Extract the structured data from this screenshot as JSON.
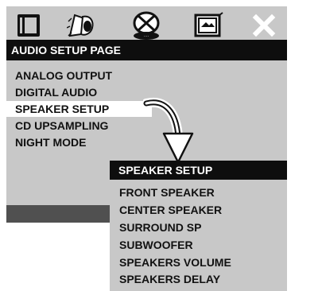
{
  "tabs": [
    {
      "icon": "monitor-icon"
    },
    {
      "icon": "speaker-icon"
    },
    {
      "icon": "disc-icon"
    },
    {
      "icon": "screen-photo-icon"
    },
    {
      "icon": "close-icon"
    }
  ],
  "page_header": "AUDIO SETUP PAGE",
  "menu_items": [
    {
      "label": "ANALOG OUTPUT"
    },
    {
      "label": "DIGITAL AUDIO"
    },
    {
      "label": "SPEAKER SETUP",
      "selected": true
    },
    {
      "label": "CD UPSAMPLING"
    },
    {
      "label": "NIGHT MODE"
    }
  ],
  "submenu": {
    "header": "SPEAKER SETUP",
    "items": [
      {
        "label": "FRONT SPEAKER"
      },
      {
        "label": "CENTER SPEAKER"
      },
      {
        "label": "SURROUND SP"
      },
      {
        "label": "SUBWOOFER"
      },
      {
        "label": "SPEAKERS VOLUME"
      },
      {
        "label": "SPEAKERS DELAY"
      }
    ]
  },
  "colors": {
    "panel": "#c8c8c8",
    "header": "#0e0e0e",
    "selected": "#ffffff",
    "footer": "#505050"
  }
}
